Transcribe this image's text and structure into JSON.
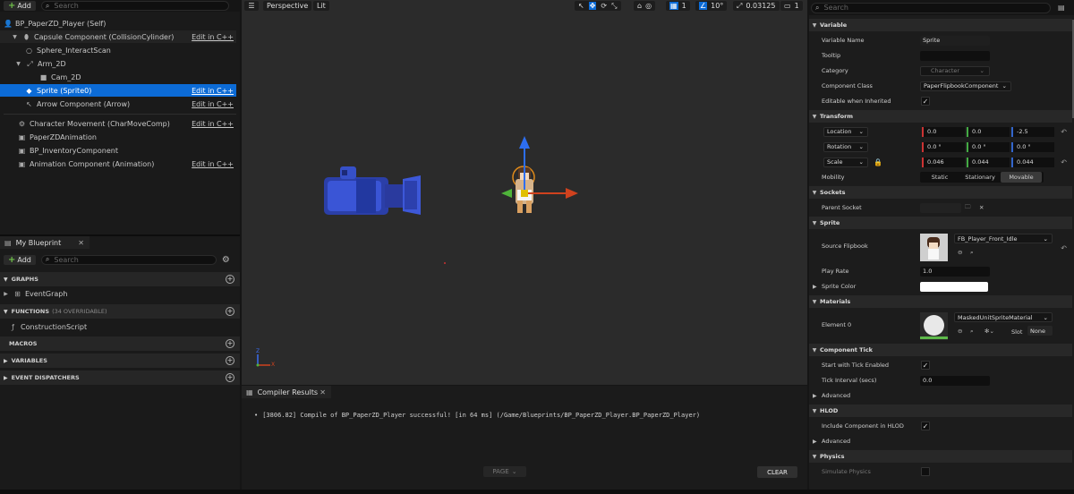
{
  "components": {
    "add_label": "Add",
    "search_placeholder": "Search",
    "root": "BP_PaperZD_Player (Self)",
    "items": [
      {
        "label": "Capsule Component (CollisionCylinder)",
        "edit": "Edit in C++"
      },
      {
        "label": "Sphere_InteractScan",
        "edit": ""
      },
      {
        "label": "Arm_2D",
        "edit": ""
      },
      {
        "label": "Cam_2D",
        "edit": ""
      },
      {
        "label": "Sprite (Sprite0)",
        "edit": "Edit in C++"
      },
      {
        "label": "Arrow Component (Arrow)",
        "edit": "Edit in C++"
      },
      {
        "label": "Character Movement (CharMoveComp)",
        "edit": "Edit in C++"
      },
      {
        "label": "PaperZDAnimation",
        "edit": ""
      },
      {
        "label": "BP_InventoryComponent",
        "edit": ""
      },
      {
        "label": "Animation Component (Animation)",
        "edit": "Edit in C++"
      }
    ]
  },
  "my_blueprint": {
    "tab_label": "My Blueprint",
    "add_label": "Add",
    "search_placeholder": "Search",
    "graphs_label": "GRAPHS",
    "event_graph": "EventGraph",
    "functions_label": "FUNCTIONS",
    "functions_note": "(34 OVERRIDABLE)",
    "construction_script": "ConstructionScript",
    "macros_label": "MACROS",
    "variables_label": "VARIABLES",
    "dispatchers_label": "EVENT DISPATCHERS"
  },
  "viewport": {
    "perspective_label": "Perspective",
    "lit_label": "Lit",
    "grid_snap": "1",
    "angle_snap": "10°",
    "scale_snap": "0.03125",
    "camera_speed": "1",
    "axis_x": "X",
    "axis_z": "Z"
  },
  "compiler": {
    "tab_label": "Compiler Results",
    "message": "[3806.82] Compile of BP_PaperZD_Player successful! [in 64 ms] (/Game/Blueprints/BP_PaperZD_Player.BP_PaperZD_Player)",
    "page_label": "PAGE",
    "clear_label": "CLEAR"
  },
  "details": {
    "search_placeholder": "Search",
    "variable": {
      "header": "Variable",
      "name_label": "Variable Name",
      "name_value": "Sprite",
      "tooltip_label": "Tooltip",
      "category_label": "Category",
      "category_value": "Character",
      "class_label": "Component Class",
      "class_value": "PaperFlipbookComponent",
      "editable_label": "Editable when Inherited"
    },
    "transform": {
      "header": "Transform",
      "location_label": "Location",
      "location": [
        "0.0",
        "0.0",
        "-2.5"
      ],
      "rotation_label": "Rotation",
      "rotation": [
        "0.0 °",
        "0.0 °",
        "0.0 °"
      ],
      "scale_label": "Scale",
      "scale": [
        "0.046",
        "0.044",
        "0.044"
      ],
      "mobility_label": "Mobility",
      "mobility_options": [
        "Static",
        "Stationary",
        "Movable"
      ]
    },
    "sockets": {
      "header": "Sockets",
      "parent_label": "Parent Socket"
    },
    "sprite": {
      "header": "Sprite",
      "flipbook_label": "Source Flipbook",
      "flipbook_value": "FB_Player_Front_Idle",
      "play_rate_label": "Play Rate",
      "play_rate_value": "1.0",
      "color_label": "Sprite Color"
    },
    "materials": {
      "header": "Materials",
      "element_label": "Element 0",
      "material_value": "MaskedUnitSpriteMaterial",
      "slot_label": "Slot",
      "slot_value": "None"
    },
    "tick": {
      "header": "Component Tick",
      "start_label": "Start with Tick Enabled",
      "interval_label": "Tick Interval (secs)",
      "interval_value": "0.0",
      "advanced_label": "Advanced"
    },
    "hlod": {
      "header": "HLOD",
      "include_label": "Include Component in HLOD",
      "advanced_label": "Advanced"
    },
    "physics": {
      "header": "Physics",
      "simulate_label": "Simulate Physics"
    }
  }
}
